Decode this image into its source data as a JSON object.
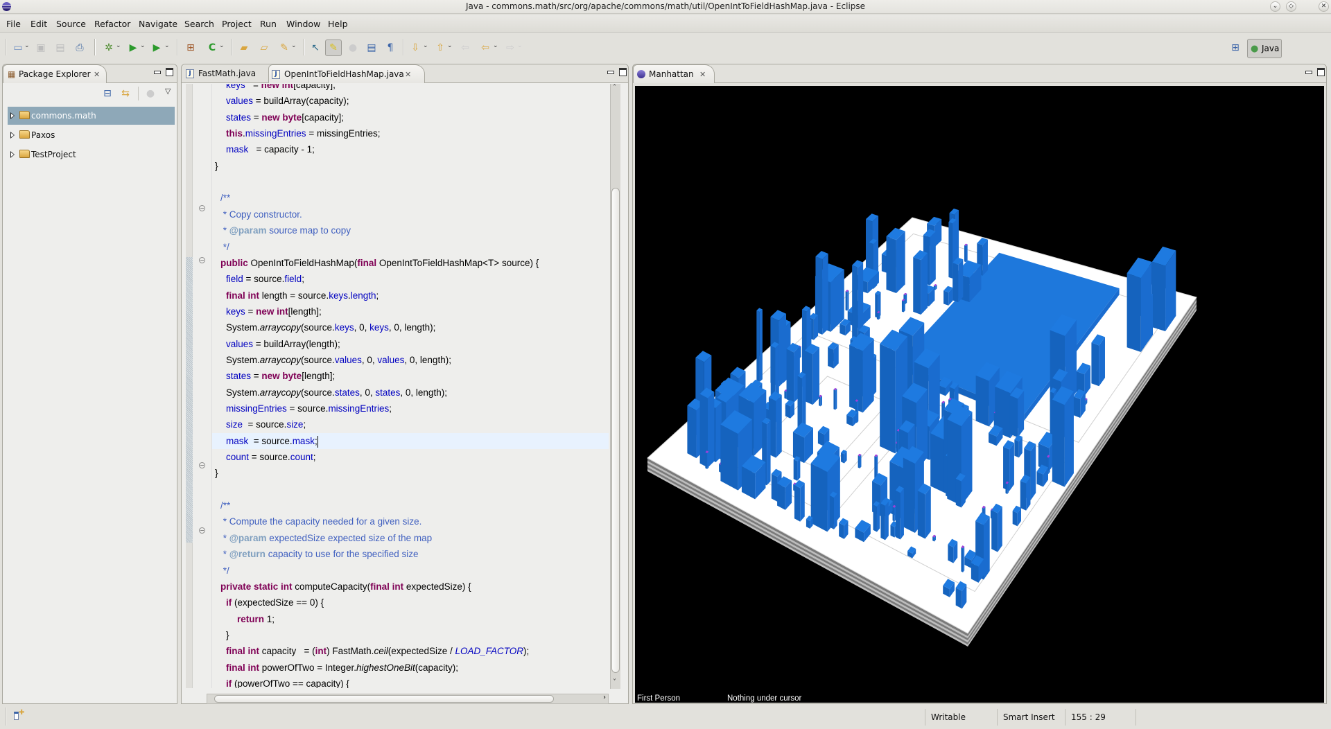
{
  "window": {
    "title": "Java - commons.math/src/org/apache/commons/math/util/OpenIntToFieldHashMap.java - Eclipse"
  },
  "menu": [
    "File",
    "Edit",
    "Source",
    "Refactor",
    "Navigate",
    "Search",
    "Project",
    "Run",
    "Window",
    "Help"
  ],
  "toolbar": {
    "perspective_label": "Java",
    "icons": [
      "new-wizard-icon",
      "save-icon",
      "save-all-icon",
      "print-icon",
      "debug-icon",
      "run-icon",
      "external-tools-icon",
      "new-java-package-icon",
      "new-java-class-icon",
      "open-type-icon",
      "open-task-icon",
      "search-icon",
      "toggle-mark-occurrences-icon",
      "toggle-highlight-icon",
      "toggle-block-selection-icon",
      "show-whitespace-icon",
      "pilcrow-icon",
      "next-annotation-icon",
      "previous-annotation-icon",
      "last-edit-icon",
      "back-icon",
      "forward-icon"
    ]
  },
  "package_explorer": {
    "title": "Package Explorer",
    "projects": [
      {
        "label": "commons.math",
        "selected": true
      },
      {
        "label": "Paxos",
        "selected": false
      },
      {
        "label": "TestProject",
        "selected": false
      }
    ]
  },
  "editor": {
    "tabs": [
      {
        "label": "FastMath.java",
        "active": false
      },
      {
        "label": "OpenIntToFieldHashMap.java",
        "active": true
      }
    ],
    "cursor_line_index": 22
  },
  "manhattan": {
    "tab_label": "Manhattan",
    "camera_mode": "First Person",
    "hover_info": "Nothing under cursor",
    "colors": {
      "building": "#1e78dc",
      "method_pole": "#9933cc",
      "ground": "#ffffff",
      "background": "#000000"
    }
  },
  "status": {
    "writable": "Writable",
    "insert_mode": "Smart Insert",
    "position": "155 : 29"
  }
}
